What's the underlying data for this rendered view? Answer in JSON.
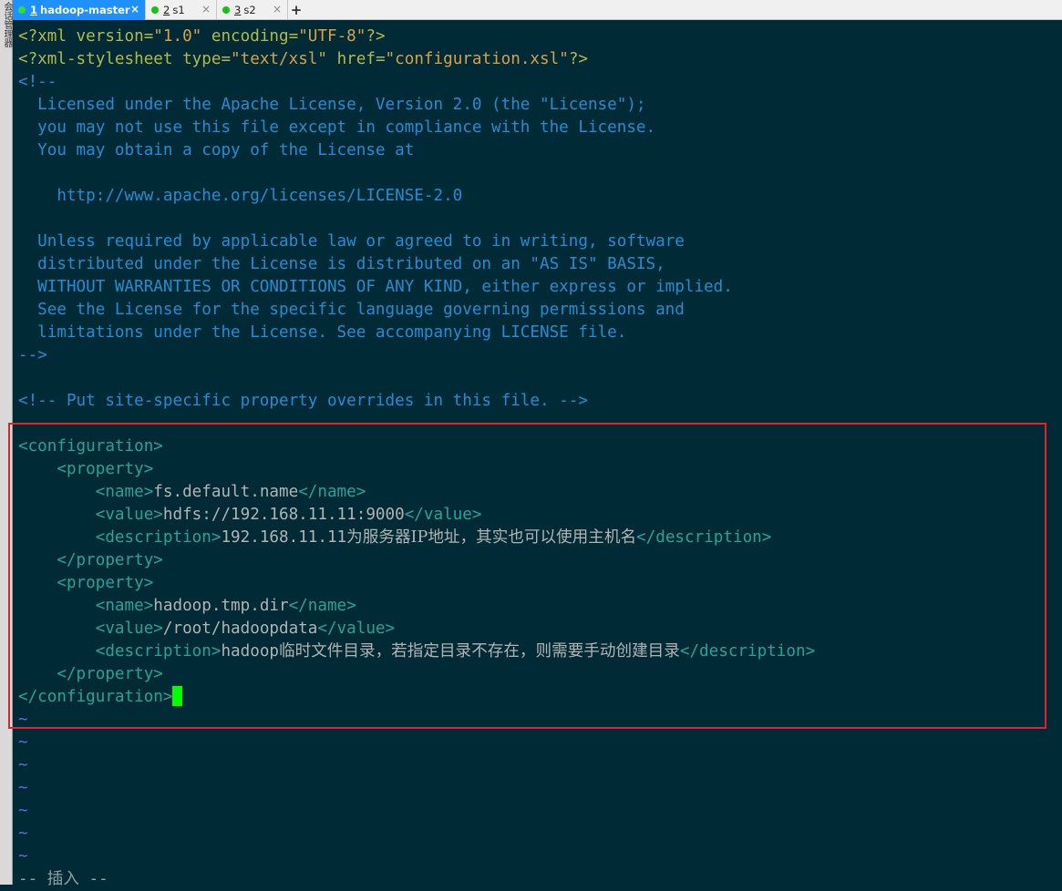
{
  "side_label": "会话管理器",
  "tabs": [
    {
      "num": "1",
      "title": "hadoop-master",
      "active": true
    },
    {
      "num": "2",
      "title": "s1",
      "active": false
    },
    {
      "num": "3",
      "title": "s2",
      "active": false
    }
  ],
  "tab_close_glyph": "×",
  "tab_add_glyph": "+",
  "colors": {
    "background": "#002b36",
    "tag": "#2aa198",
    "comment": "#268bd2",
    "string": "#d6a14a",
    "cursor": "#00ff00",
    "highlight_border": "#e0242c",
    "active_tab": "#1e90ff"
  },
  "lines": [
    [
      {
        "t": "<?xml version=",
        "c": "pi"
      },
      {
        "t": "\"1.0\"",
        "c": "str"
      },
      {
        "t": " encoding=",
        "c": "pi"
      },
      {
        "t": "\"UTF-8\"",
        "c": "str"
      },
      {
        "t": "?>",
        "c": "pi"
      }
    ],
    [
      {
        "t": "<?xml-stylesheet type=",
        "c": "pi"
      },
      {
        "t": "\"text/xsl\"",
        "c": "str"
      },
      {
        "t": " href=",
        "c": "pi"
      },
      {
        "t": "\"configuration.xsl\"",
        "c": "str"
      },
      {
        "t": "?>",
        "c": "pi"
      }
    ],
    [
      {
        "t": "<!--",
        "c": "cm"
      }
    ],
    [
      {
        "t": "  Licensed under the Apache License, Version 2.0 (the \"License\");",
        "c": "cm"
      }
    ],
    [
      {
        "t": "  you may not use this file except in compliance with the License.",
        "c": "cm"
      }
    ],
    [
      {
        "t": "  You may obtain a copy of the License at",
        "c": "cm"
      }
    ],
    [],
    [
      {
        "t": "    http://www.apache.org/licenses/LICENSE-2.0",
        "c": "cm"
      }
    ],
    [],
    [
      {
        "t": "  Unless required by applicable law or agreed to in writing, software",
        "c": "cm"
      }
    ],
    [
      {
        "t": "  distributed under the License is distributed on an \"AS IS\" BASIS,",
        "c": "cm"
      }
    ],
    [
      {
        "t": "  WITHOUT WARRANTIES OR CONDITIONS OF ANY KIND, either express or implied.",
        "c": "cm"
      }
    ],
    [
      {
        "t": "  See the License for the specific language governing permissions and",
        "c": "cm"
      }
    ],
    [
      {
        "t": "  limitations under the License. See accompanying LICENSE file.",
        "c": "cm"
      }
    ],
    [
      {
        "t": "-->",
        "c": "cm"
      }
    ],
    [],
    [
      {
        "t": "<!-- Put site-specific property overrides in this file. -->",
        "c": "cm"
      }
    ],
    [],
    [
      {
        "t": "<configuration>",
        "c": "tag"
      }
    ],
    [
      {
        "t": "    <property>",
        "c": "tag"
      }
    ],
    [
      {
        "t": "        <name>",
        "c": "tag"
      },
      {
        "t": "fs.default.name",
        "c": "txt"
      },
      {
        "t": "</name>",
        "c": "tag"
      }
    ],
    [
      {
        "t": "        <value>",
        "c": "tag"
      },
      {
        "t": "hdfs://192.168.11.11:9000",
        "c": "txt"
      },
      {
        "t": "</value>",
        "c": "tag"
      }
    ],
    [
      {
        "t": "        <description>",
        "c": "tag"
      },
      {
        "t": "192.168.11.11",
        "c": "txt"
      },
      {
        "t": "为服务器IP地址，其实也可以使用主机名",
        "c": "txt cjk"
      },
      {
        "t": "</description>",
        "c": "tag"
      }
    ],
    [
      {
        "t": "    </property>",
        "c": "tag"
      }
    ],
    [
      {
        "t": "    <property>",
        "c": "tag"
      }
    ],
    [
      {
        "t": "        <name>",
        "c": "tag"
      },
      {
        "t": "hadoop.tmp.dir",
        "c": "txt"
      },
      {
        "t": "</name>",
        "c": "tag"
      }
    ],
    [
      {
        "t": "        <value>",
        "c": "tag"
      },
      {
        "t": "/root/hadoopdata",
        "c": "txt"
      },
      {
        "t": "</value>",
        "c": "tag"
      }
    ],
    [
      {
        "t": "        <description>",
        "c": "tag"
      },
      {
        "t": "hadoop",
        "c": "txt"
      },
      {
        "t": "临时文件目录，若指定目录不存在，则需要手动创建目录",
        "c": "txt cjk"
      },
      {
        "t": "</description>",
        "c": "tag"
      }
    ],
    [
      {
        "t": "    </property>",
        "c": "tag"
      }
    ],
    [
      {
        "t": "</configuration>",
        "c": "tag"
      },
      {
        "cursor": true
      }
    ],
    [
      {
        "t": "~",
        "c": "tilde"
      }
    ],
    [
      {
        "t": "~",
        "c": "tilde"
      }
    ],
    [
      {
        "t": "~",
        "c": "tilde"
      }
    ],
    [
      {
        "t": "~",
        "c": "tilde"
      }
    ],
    [
      {
        "t": "~",
        "c": "tilde"
      }
    ],
    [
      {
        "t": "~",
        "c": "tilde"
      }
    ],
    [
      {
        "t": "~",
        "c": "tilde"
      }
    ],
    [
      {
        "t": "-- 插入 --",
        "c": "mode"
      }
    ]
  ]
}
